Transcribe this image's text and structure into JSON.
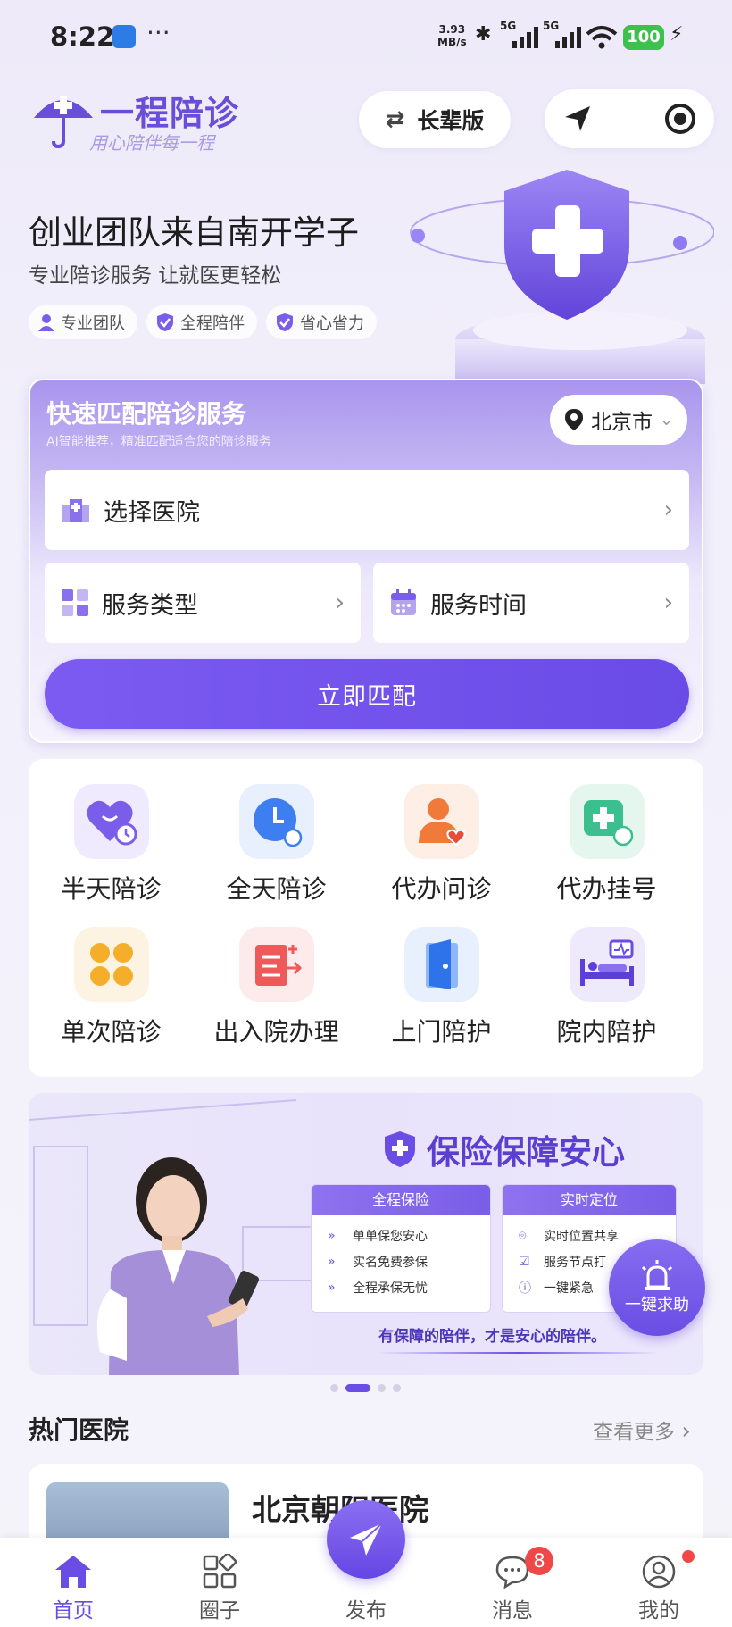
{
  "status_bar": {
    "time": "8:22",
    "more": "···",
    "speed": "3.93",
    "speed_unit": "MB/s",
    "net1": "5G",
    "net2": "5G",
    "battery": "100"
  },
  "header": {
    "brand": "一程陪诊",
    "slogan": "用心陪伴每一程",
    "elder_mode": "长辈版"
  },
  "hero": {
    "title": "创业团队来自南开学子",
    "subtitle": "专业陪诊服务 让就医更轻松",
    "tags": [
      "专业团队",
      "全程陪伴",
      "省心省力"
    ]
  },
  "match": {
    "title": "快速匹配陪诊服务",
    "subtitle": "AI智能推荐，精准匹配适合您的陪诊服务",
    "city": "北京市",
    "hospital": "选择医院",
    "service_type": "服务类型",
    "service_time": "服务时间",
    "button": "立即匹配"
  },
  "services": [
    {
      "label": "半天陪诊",
      "icon": "heart-clock-icon"
    },
    {
      "label": "全天陪诊",
      "icon": "clock-icon"
    },
    {
      "label": "代办问诊",
      "icon": "person-heart-icon"
    },
    {
      "label": "代办挂号",
      "icon": "medical-add-icon"
    },
    {
      "label": "单次陪诊",
      "icon": "four-petal-icon"
    },
    {
      "label": "出入院办理",
      "icon": "transfer-icon"
    },
    {
      "label": "上门陪护",
      "icon": "door-icon"
    },
    {
      "label": "院内陪护",
      "icon": "hospital-bed-icon"
    }
  ],
  "banner": {
    "title": "保险保障安心",
    "card1": {
      "title": "全程保险",
      "items": [
        "单单保您安心",
        "实名免费参保",
        "全程承保无忧"
      ]
    },
    "card2": {
      "title": "实时定位",
      "items": [
        "实时位置共享",
        "服务节点打",
        "一键紧急"
      ]
    },
    "footer": "有保障的陪伴，才是安心的陪伴。"
  },
  "sos": "一键求助",
  "hot": {
    "title": "热门医院",
    "more": "查看更多",
    "hospital_name": "北京朝阳医院"
  },
  "tabbar": {
    "home": "首页",
    "circle": "圈子",
    "publish": "发布",
    "messages": "消息",
    "messages_badge": "8",
    "mine": "我的"
  },
  "colors": {
    "accent": "#6a4de4",
    "brand": "#6a4dd8",
    "badge": "#f04848"
  }
}
